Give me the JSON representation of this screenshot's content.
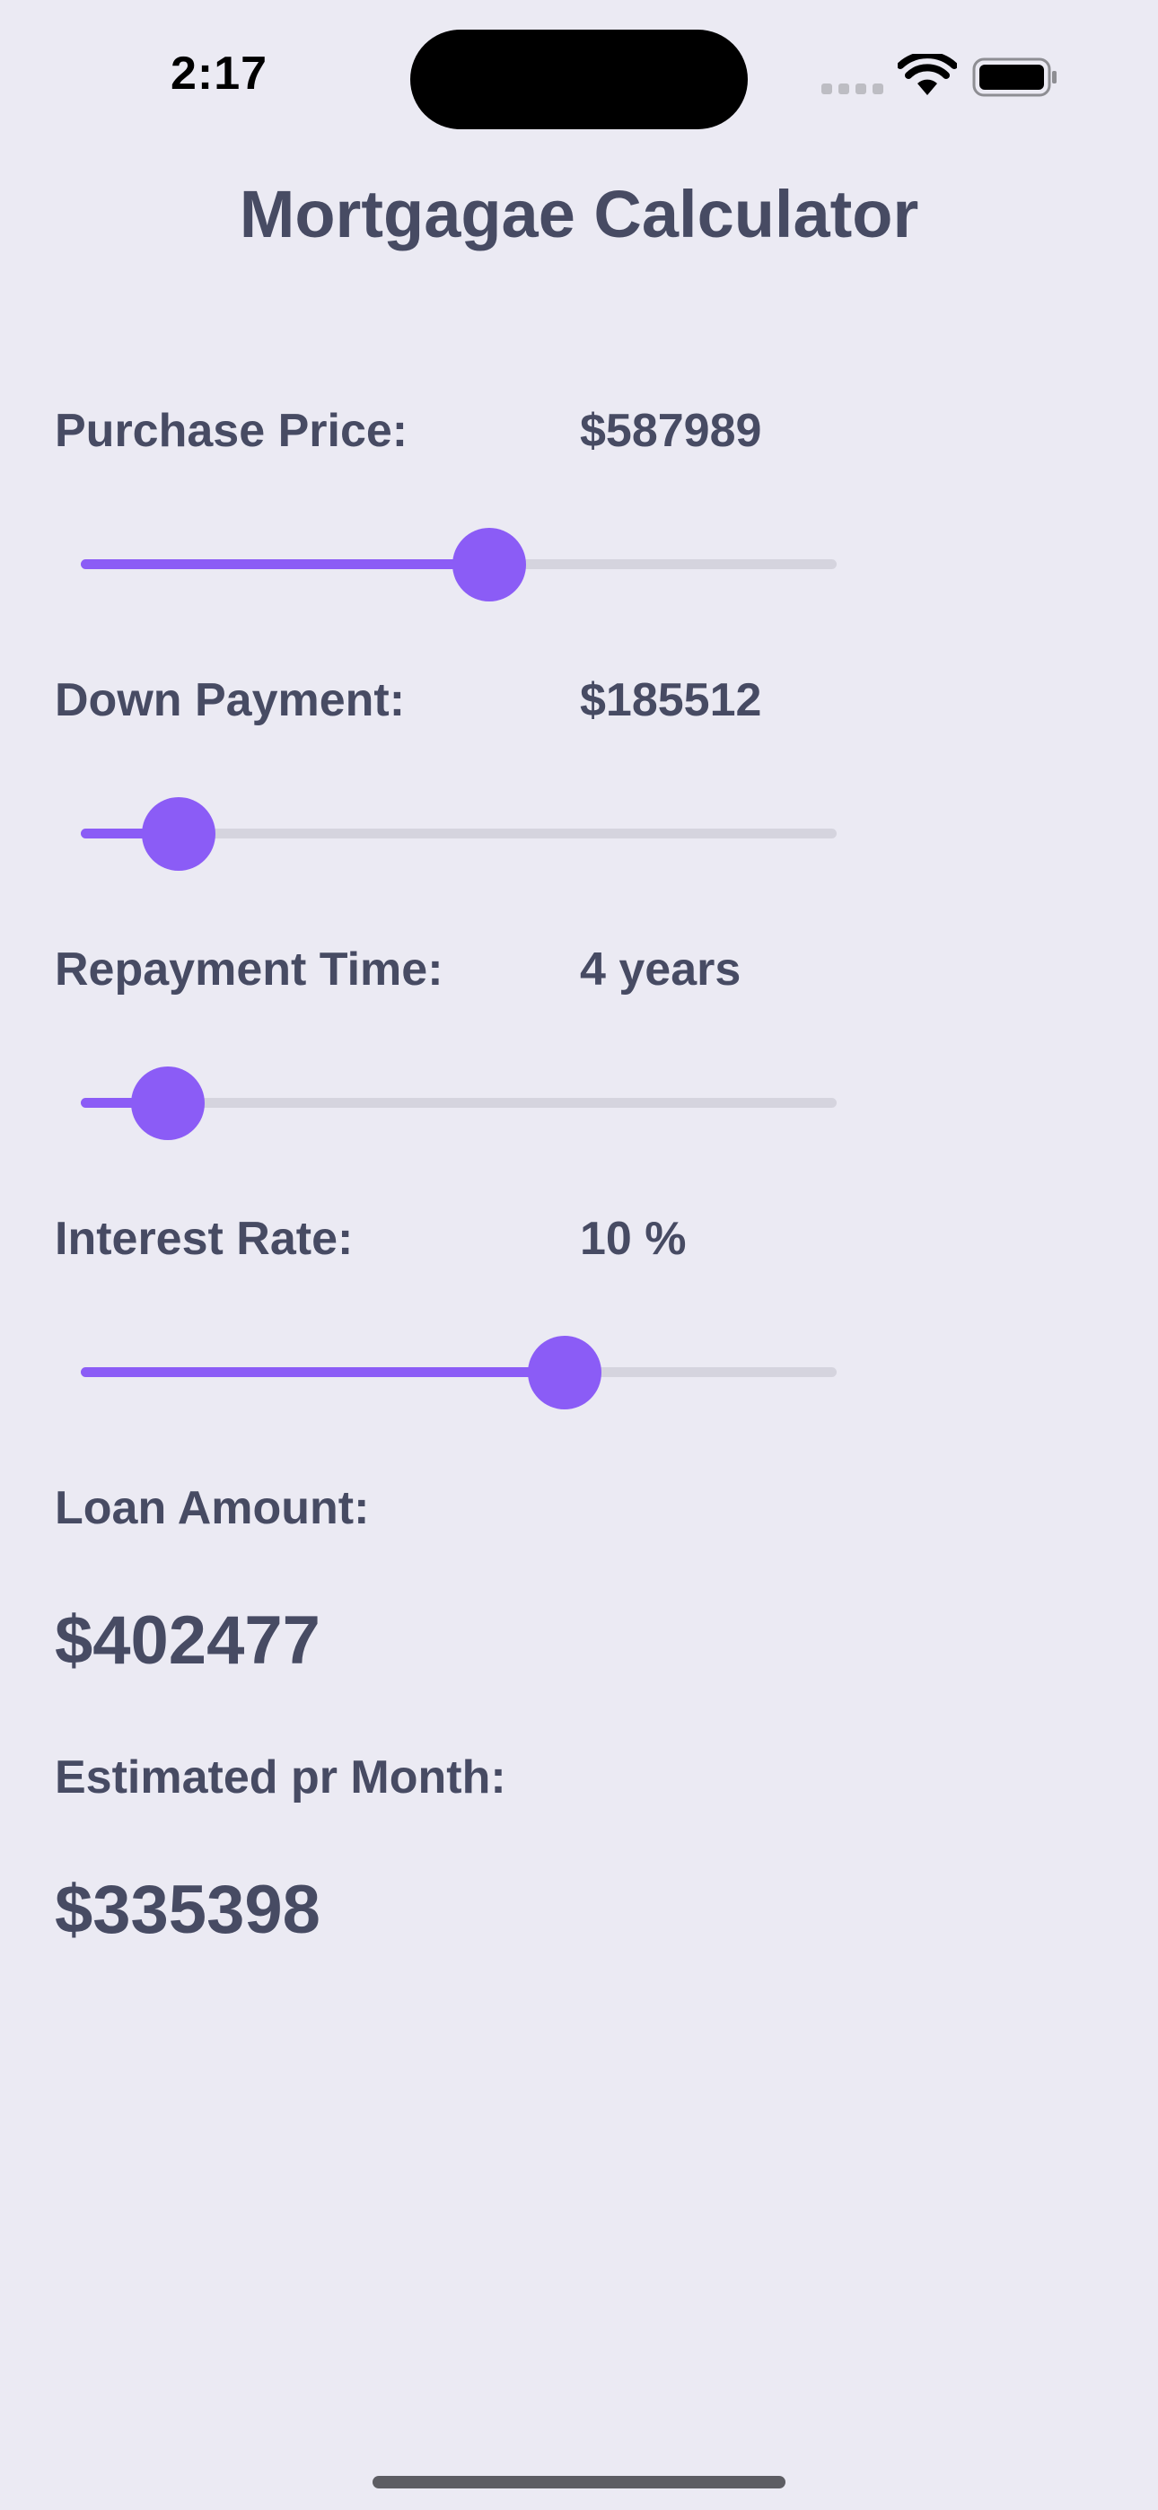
{
  "status_bar": {
    "time": "2:17"
  },
  "title": "Mortgagae Calculator",
  "fields": {
    "purchase_price": {
      "label": "Purchase Price:",
      "value": "$587989",
      "slider_fraction": 0.54
    },
    "down_payment": {
      "label": "Down Payment:",
      "value": "$185512",
      "slider_fraction": 0.13
    },
    "repayment_time": {
      "label": "Repayment Time:",
      "value": "4 years",
      "slider_fraction": 0.115
    },
    "interest_rate": {
      "label": "Interest Rate:",
      "value": "10 %",
      "slider_fraction": 0.64
    }
  },
  "results": {
    "loan_amount": {
      "label": "Loan Amount:",
      "value": "$402477"
    },
    "monthly": {
      "label": "Estimated pr Month:",
      "value": "$335398"
    }
  },
  "colors": {
    "accent": "#8b5cf6",
    "track": "#d5d4de",
    "text": "#474b63",
    "background": "#ebeaf3"
  }
}
